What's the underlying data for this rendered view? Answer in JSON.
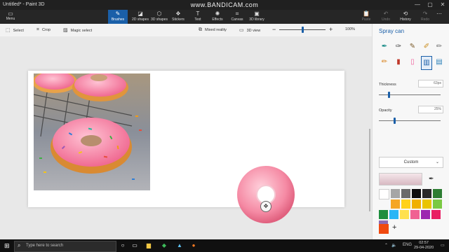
{
  "window": {
    "title": "Untitled* - Paint 3D",
    "watermark": "www.BANDICAM.com",
    "minimize": "—",
    "maximize": "▢",
    "close": "✕"
  },
  "ribbon": {
    "menu_label": "Menu",
    "tabs": [
      {
        "label": "Brushes",
        "icon": "brush-icon"
      },
      {
        "label": "2D shapes",
        "icon": "shapes-2d-icon"
      },
      {
        "label": "3D shapes",
        "icon": "cube-icon"
      },
      {
        "label": "Stickers",
        "icon": "sticker-icon"
      },
      {
        "label": "Text",
        "icon": "text-icon"
      },
      {
        "label": "Effects",
        "icon": "effects-icon"
      },
      {
        "label": "Canvas",
        "icon": "canvas-icon"
      },
      {
        "label": "3D library",
        "icon": "library-icon"
      }
    ],
    "right_actions": [
      {
        "label": "Paste"
      },
      {
        "label": "Undo"
      },
      {
        "label": "History"
      },
      {
        "label": "Redo"
      }
    ]
  },
  "toolbar": {
    "select": "Select",
    "crop": "Crop",
    "magic_select": "Magic select",
    "mixed_reality": "Mixed reality",
    "view_3d": "3D view",
    "zoom_out": "−",
    "zoom_in": "+",
    "zoom_value": "100%"
  },
  "panel": {
    "title": "Spray can",
    "thickness_label": "Thickness",
    "thickness_value": "63px",
    "thickness_fraction": 0.12,
    "opacity_label": "Opacity",
    "opacity_value": "25%",
    "opacity_fraction": 0.25,
    "color_mode": "Custom",
    "palette": [
      "#ffffff",
      "#a6a6a6",
      "#6b6b6b",
      "#0d0d0d",
      "#2a2a2a",
      "#2d7d32",
      "#f5a623",
      "#ffd11a",
      "#f0b000",
      "#e9c400",
      "#7ac943",
      "#1e8e3e",
      "#29b6f6",
      "#ffe14d",
      "#f06292",
      "#9c27b0",
      "#e91e63",
      "#8e6bb3"
    ],
    "custom_color": "#f04a10"
  },
  "taskbar": {
    "search_placeholder": "Type here to search",
    "language": "ENG",
    "time": "02:57",
    "date": "29-04-2020"
  }
}
